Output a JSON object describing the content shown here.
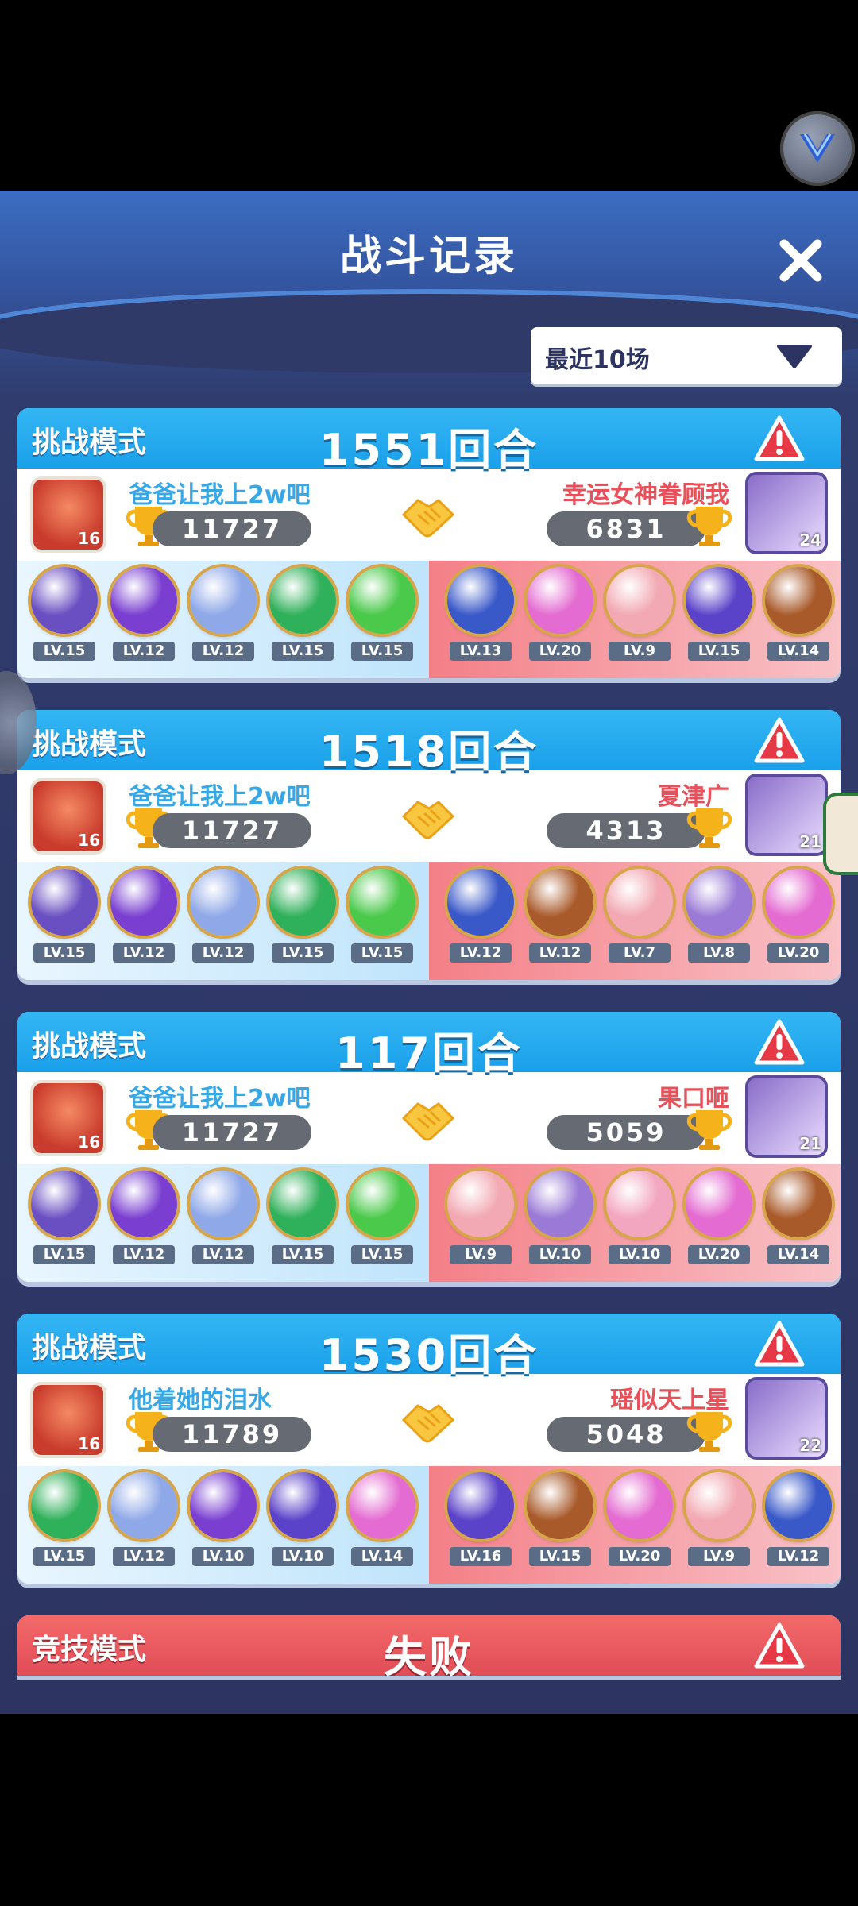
{
  "panel": {
    "title": "战斗记录",
    "filter_label": "最近10场"
  },
  "records": [
    {
      "mode": "挑战模式",
      "result": "1551回合",
      "left_player": {
        "name": "爸爸让我上2w吧",
        "score": "11727",
        "level": "16"
      },
      "right_player": {
        "name": "幸运女神眷顾我",
        "score": "6831",
        "level": "24"
      },
      "left_pets": [
        {
          "lv": "LV.15",
          "color": "#6a4fc2"
        },
        {
          "lv": "LV.12",
          "color": "#7a3fd1"
        },
        {
          "lv": "LV.12",
          "color": "#8fa8e8"
        },
        {
          "lv": "LV.15",
          "color": "#2fb05a"
        },
        {
          "lv": "LV.15",
          "color": "#4ac94a"
        }
      ],
      "right_pets": [
        {
          "lv": "LV.13",
          "color": "#3a59c9"
        },
        {
          "lv": "LV.20",
          "color": "#e46bd1"
        },
        {
          "lv": "LV.9",
          "color": "#f2a9b3"
        },
        {
          "lv": "LV.15",
          "color": "#5b43c9"
        },
        {
          "lv": "LV.14",
          "color": "#a95a2a"
        }
      ]
    },
    {
      "mode": "挑战模式",
      "result": "1518回合",
      "left_player": {
        "name": "爸爸让我上2w吧",
        "score": "11727",
        "level": "16"
      },
      "right_player": {
        "name": "夏津广",
        "score": "4313",
        "level": "21"
      },
      "left_pets": [
        {
          "lv": "LV.15",
          "color": "#6a4fc2"
        },
        {
          "lv": "LV.12",
          "color": "#7a3fd1"
        },
        {
          "lv": "LV.12",
          "color": "#8fa8e8"
        },
        {
          "lv": "LV.15",
          "color": "#2fb05a"
        },
        {
          "lv": "LV.15",
          "color": "#4ac94a"
        }
      ],
      "right_pets": [
        {
          "lv": "LV.12",
          "color": "#3a59c9"
        },
        {
          "lv": "LV.12",
          "color": "#a95a2a"
        },
        {
          "lv": "LV.7",
          "color": "#f2a9b3"
        },
        {
          "lv": "LV.8",
          "color": "#9a7ad6"
        },
        {
          "lv": "LV.20",
          "color": "#e46bd1"
        }
      ]
    },
    {
      "mode": "挑战模式",
      "result": "117回合",
      "left_player": {
        "name": "爸爸让我上2w吧",
        "score": "11727",
        "level": "16"
      },
      "right_player": {
        "name": "果口咂",
        "score": "5059",
        "level": "21"
      },
      "left_pets": [
        {
          "lv": "LV.15",
          "color": "#6a4fc2"
        },
        {
          "lv": "LV.12",
          "color": "#7a3fd1"
        },
        {
          "lv": "LV.12",
          "color": "#8fa8e8"
        },
        {
          "lv": "LV.15",
          "color": "#2fb05a"
        },
        {
          "lv": "LV.15",
          "color": "#4ac94a"
        }
      ],
      "right_pets": [
        {
          "lv": "LV.9",
          "color": "#f2a9b3"
        },
        {
          "lv": "LV.10",
          "color": "#9a7ad6"
        },
        {
          "lv": "LV.10",
          "color": "#f3a6c0"
        },
        {
          "lv": "LV.20",
          "color": "#e46bd1"
        },
        {
          "lv": "LV.14",
          "color": "#a95a2a"
        }
      ]
    },
    {
      "mode": "挑战模式",
      "result": "1530回合",
      "left_player": {
        "name": "他着她的泪水",
        "score": "11789",
        "level": "16"
      },
      "right_player": {
        "name": "瑶似天上星",
        "score": "5048",
        "level": "22"
      },
      "left_pets": [
        {
          "lv": "LV.15",
          "color": "#2fb05a"
        },
        {
          "lv": "LV.12",
          "color": "#8fa8e8"
        },
        {
          "lv": "LV.10",
          "color": "#7a3fd1"
        },
        {
          "lv": "LV.10",
          "color": "#5b43c9"
        },
        {
          "lv": "LV.14",
          "color": "#e46bd1"
        }
      ],
      "right_pets": [
        {
          "lv": "LV.16",
          "color": "#5b43c9"
        },
        {
          "lv": "LV.15",
          "color": "#a95a2a"
        },
        {
          "lv": "LV.20",
          "color": "#e46bd1"
        },
        {
          "lv": "LV.9",
          "color": "#f2a9b3"
        },
        {
          "lv": "LV.12",
          "color": "#3a59c9"
        }
      ]
    },
    {
      "mode": "竞技模式",
      "result": "失败"
    }
  ]
}
